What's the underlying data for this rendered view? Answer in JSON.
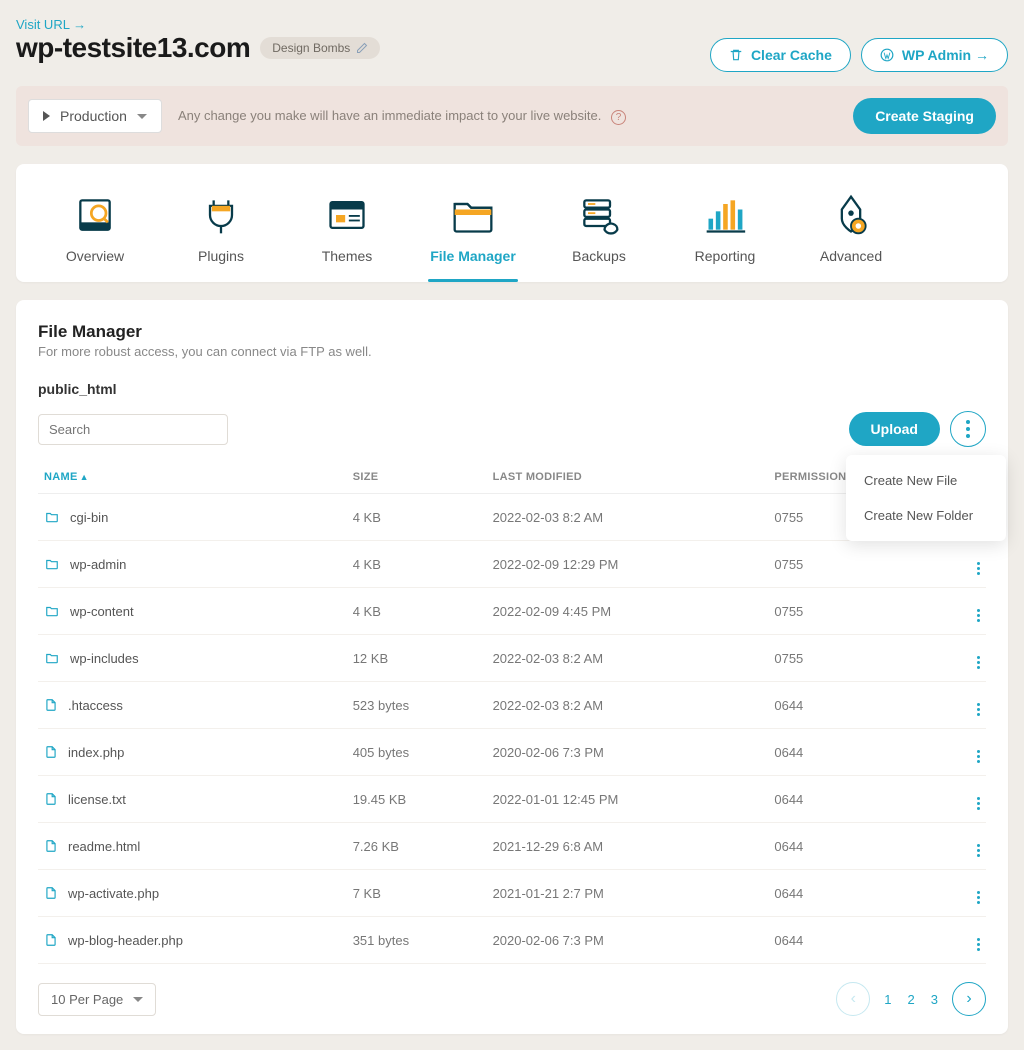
{
  "topLink": "Visit URL →",
  "siteTitle": "wp-testsite13.com",
  "designPill": "Design Bombs",
  "clearCacheLabel": "Clear Cache",
  "wpAdminLabel": "WP Admin →",
  "envLabel": "Production",
  "bannerText": "Any change you make will have an immediate impact to your live website.",
  "createStagingLabel": "Create Staging",
  "tabs": [
    {
      "label": "Overview"
    },
    {
      "label": "Plugins"
    },
    {
      "label": "Themes"
    },
    {
      "label": "File Manager"
    },
    {
      "label": "Backups"
    },
    {
      "label": "Reporting"
    },
    {
      "label": "Advanced"
    }
  ],
  "fm": {
    "title": "File Manager",
    "subtitle": "For more robust access, you can connect via FTP as well.",
    "breadcrumb": "public_html",
    "searchPlaceholder": "Search",
    "uploadLabel": "Upload",
    "menu": {
      "newFile": "Create New File",
      "newFolder": "Create New Folder"
    },
    "cols": {
      "name": "NAME",
      "size": "SIZE",
      "modified": "LAST MODIFIED",
      "perm": "PERMISSIONS"
    },
    "rows": [
      {
        "type": "folder",
        "name": "cgi-bin",
        "size": "4 KB",
        "mod": "2022-02-03 8:2 AM",
        "perm": "0755"
      },
      {
        "type": "folder",
        "name": "wp-admin",
        "size": "4 KB",
        "mod": "2022-02-09 12:29 PM",
        "perm": "0755"
      },
      {
        "type": "folder",
        "name": "wp-content",
        "size": "4 KB",
        "mod": "2022-02-09 4:45 PM",
        "perm": "0755"
      },
      {
        "type": "folder",
        "name": "wp-includes",
        "size": "12 KB",
        "mod": "2022-02-03 8:2 AM",
        "perm": "0755"
      },
      {
        "type": "file",
        "name": ".htaccess",
        "size": "523 bytes",
        "mod": "2022-02-03 8:2 AM",
        "perm": "0644"
      },
      {
        "type": "file",
        "name": "index.php",
        "size": "405 bytes",
        "mod": "2020-02-06 7:3 PM",
        "perm": "0644"
      },
      {
        "type": "file",
        "name": "license.txt",
        "size": "19.45 KB",
        "mod": "2022-01-01 12:45 PM",
        "perm": "0644"
      },
      {
        "type": "file",
        "name": "readme.html",
        "size": "7.26 KB",
        "mod": "2021-12-29 6:8 AM",
        "perm": "0644"
      },
      {
        "type": "file",
        "name": "wp-activate.php",
        "size": "7 KB",
        "mod": "2021-01-21 2:7 PM",
        "perm": "0644"
      },
      {
        "type": "file",
        "name": "wp-blog-header.php",
        "size": "351 bytes",
        "mod": "2020-02-06 7:3 PM",
        "perm": "0644"
      }
    ],
    "perPageLabel": "10 Per Page",
    "pages": [
      "1",
      "2",
      "3"
    ]
  },
  "colors": {
    "accent": "#1fa6c5",
    "orange": "#f5a623"
  }
}
